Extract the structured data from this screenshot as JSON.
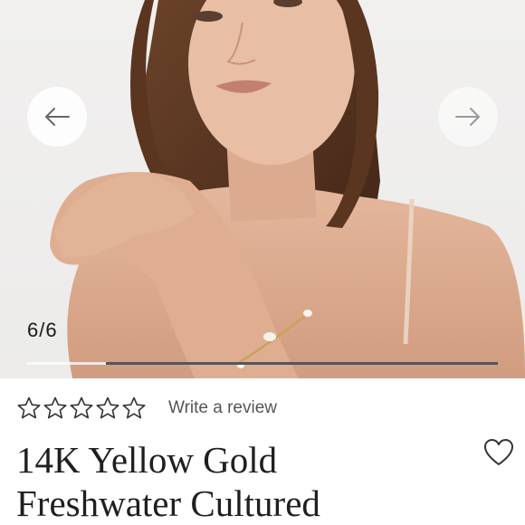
{
  "gallery": {
    "counter_current": "6",
    "counter_separator": "/",
    "counter_total": "6",
    "progress": 0.833,
    "prev_icon": "arrow-left-icon",
    "next_icon": "arrow-right-icon"
  },
  "rating": {
    "stars_filled": 0,
    "stars_total": 5,
    "review_label": "Write a review"
  },
  "product": {
    "title_line1": "14K Yellow Gold",
    "title_line2": "Freshwater Cultured"
  },
  "wishlist": {
    "icon": "heart-icon"
  },
  "colors": {
    "text": "#1f1f1f",
    "muted": "#555555",
    "star_outline": "#333333"
  }
}
